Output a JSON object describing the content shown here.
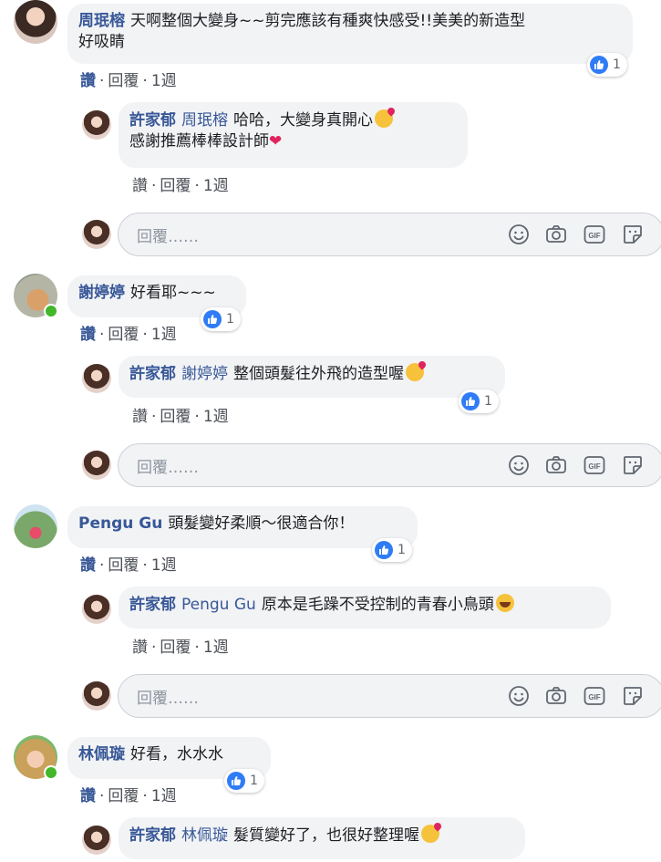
{
  "reply_box": {
    "placeholder": "回覆……"
  },
  "actions": {
    "like": "讚",
    "reply": "回覆",
    "time": "1週",
    "dot": "·"
  },
  "comments": [
    {
      "author": "周珉榕",
      "text_line1": "天啊整個大變身~~剪完應該有種爽快感受!!美美的新造型",
      "text_line2": "好吸睛",
      "reactions": "1",
      "online": false,
      "reply": {
        "author": "許家郁",
        "mention": "周珉榕",
        "text_line1": "哈哈，大變身真開心",
        "text_line2": "感謝推薦棒棒設計師",
        "emoji1": "kiss",
        "emoji2": "heart"
      }
    },
    {
      "author": "謝婷婷",
      "text": "好看耶~~~",
      "reactions": "1",
      "online": true,
      "reply": {
        "author": "許家郁",
        "mention": "謝婷婷",
        "text": "整個頭髮往外飛的造型喔",
        "emoji": "kiss",
        "reactions": "1"
      }
    },
    {
      "author": "Pengu Gu",
      "text": "頭髮變好柔順～很適合你！",
      "reactions": "1",
      "online": false,
      "reply": {
        "author": "許家郁",
        "mention": "Pengu Gu",
        "text": "原本是毛躁不受控制的青春小鳥頭",
        "emoji": "laugh"
      }
    },
    {
      "author": "林佩璇",
      "text": "好看，水水水",
      "reactions": "1",
      "online": true,
      "reply": {
        "author": "許家郁",
        "mention": "林佩璇",
        "text": "髮質變好了，也很好整理喔",
        "emoji": "kiss"
      }
    }
  ],
  "icons": [
    "smiley-icon",
    "camera-icon",
    "gif-icon",
    "sticker-icon",
    "like-thumb-icon"
  ],
  "colors": {
    "author": "#385898",
    "bubble": "#f2f3f5",
    "like_badge": "#2f7cf6",
    "online": "#42b72a"
  }
}
